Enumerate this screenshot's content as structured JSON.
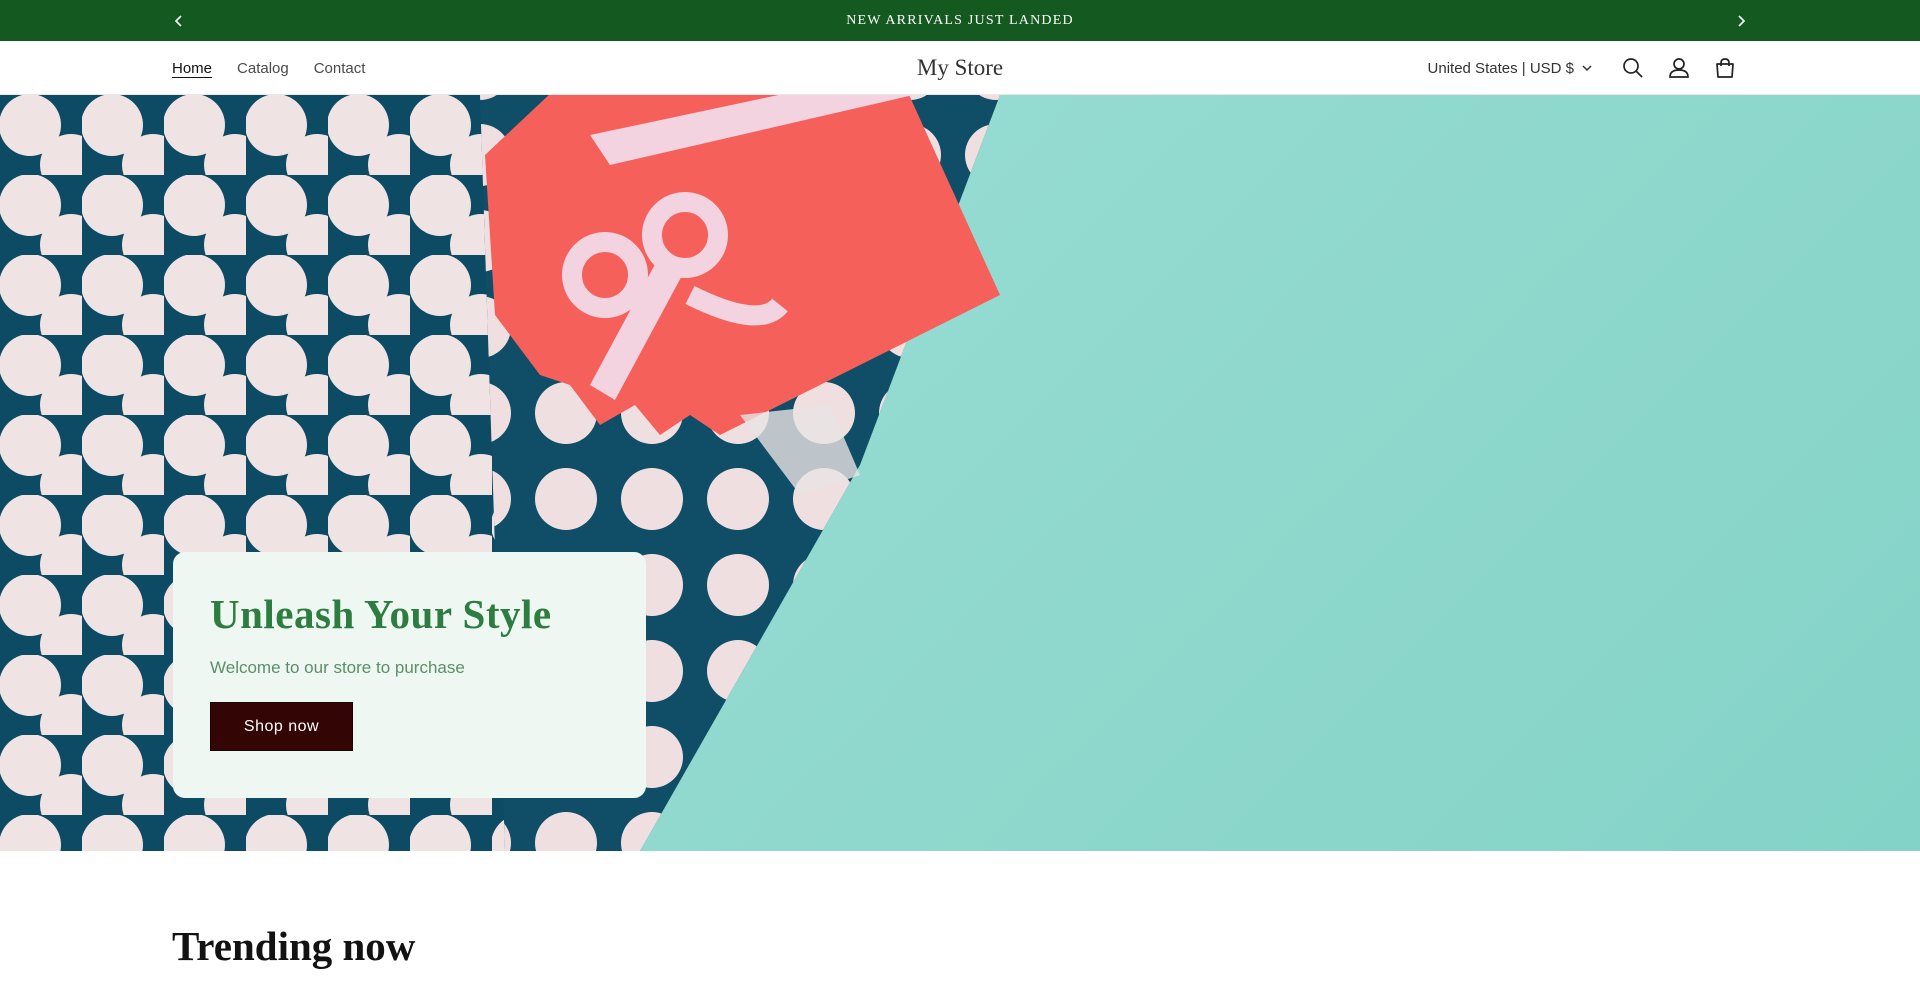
{
  "announcement": {
    "text": "NEW ARRIVALS JUST LANDED",
    "prev_icon": "chevron-left-icon",
    "next_icon": "chevron-right-icon",
    "background": "#145a20"
  },
  "header": {
    "nav": [
      {
        "label": "Home",
        "active": true
      },
      {
        "label": "Catalog",
        "active": false
      },
      {
        "label": "Contact",
        "active": false
      }
    ],
    "logo": "My Store",
    "locale": "United States | USD $",
    "icons": [
      "search-icon",
      "account-icon",
      "cart-icon"
    ]
  },
  "hero": {
    "title": "Unleash Your Style",
    "subtitle": "Welcome to our store to purchase",
    "button": "Shop now",
    "image": "gift-card-polka-dot-envelope",
    "colors": {
      "accent": "#2e7d40",
      "button": "#330505",
      "card": "#eef7f2"
    }
  },
  "sections": {
    "trending_title": "Trending now"
  }
}
